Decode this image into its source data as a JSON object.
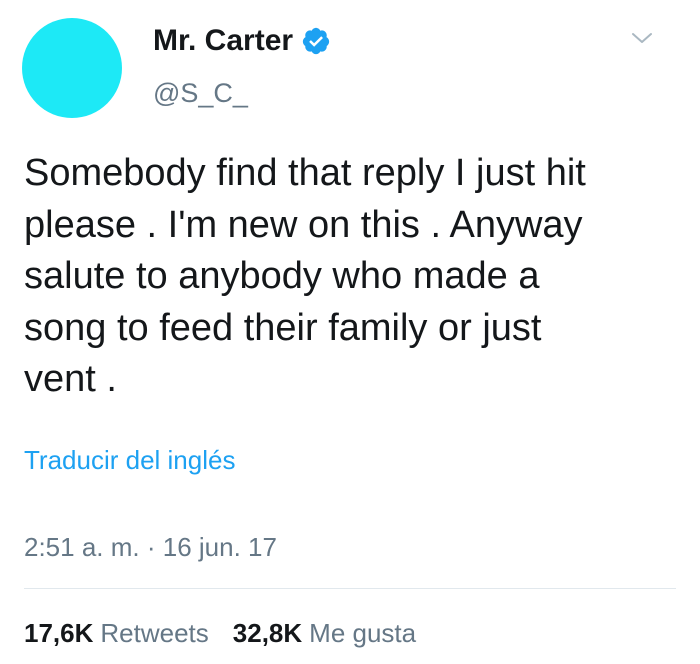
{
  "tweet": {
    "author": {
      "display_name": "Mr. Carter",
      "handle": "@S_C_",
      "verified": true,
      "avatar_color": "#1de9f6"
    },
    "text": "Somebody find that reply I just hit\nplease . I'm new on this . Anyway\nsalute to anybody who made a\nsong to feed their family or just\nvent .",
    "translate_label": "Traducir del inglés",
    "time": "2:51 a. m.",
    "separator": " · ",
    "date": "16 jun. 17",
    "stats": {
      "retweets_count": "17,6K",
      "retweets_label": "Retweets",
      "likes_count": "32,8K",
      "likes_label": "Me gusta"
    },
    "menu_icon": "chevron-down-icon",
    "badge_icon": "verified-badge-icon"
  },
  "colors": {
    "link": "#1da1f2",
    "secondary_text": "#657786",
    "primary_text": "#14171a",
    "verified_badge": "#1da1f2"
  }
}
